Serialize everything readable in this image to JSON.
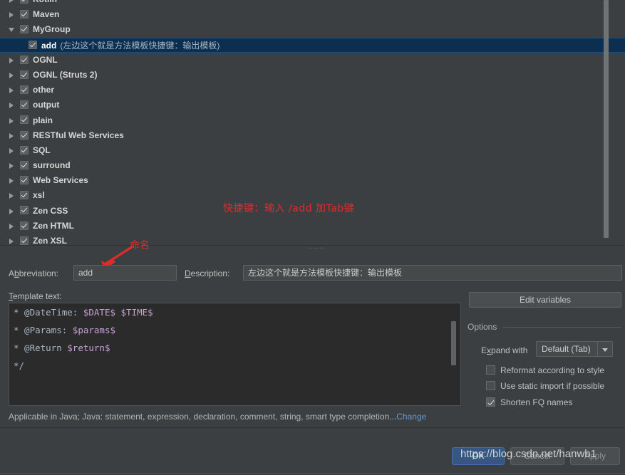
{
  "theme": {
    "window_bg": "#3c3f41",
    "selection_bg": "#0d2f4f",
    "editor_bg": "#2b2b2b",
    "accent_blue": "#365880",
    "link_blue": "#6897d0",
    "annotation_red": "#e02b2b",
    "variable_purple": "#c8a0d8"
  },
  "tree": {
    "rows": [
      {
        "label": "Kotlin",
        "description": "",
        "expandable": true,
        "expanded": false,
        "checked": true,
        "child": false,
        "selected": false
      },
      {
        "label": "Maven",
        "description": "",
        "expandable": true,
        "expanded": false,
        "checked": true,
        "child": false,
        "selected": false
      },
      {
        "label": "MyGroup",
        "description": "",
        "expandable": true,
        "expanded": true,
        "checked": true,
        "child": false,
        "selected": false
      },
      {
        "label": "add",
        "description": "(左边这个就是方法模板快捷键：输出模板)",
        "expandable": false,
        "expanded": false,
        "checked": true,
        "child": true,
        "selected": true
      },
      {
        "label": "OGNL",
        "description": "",
        "expandable": true,
        "expanded": false,
        "checked": true,
        "child": false,
        "selected": false
      },
      {
        "label": "OGNL (Struts 2)",
        "description": "",
        "expandable": true,
        "expanded": false,
        "checked": true,
        "child": false,
        "selected": false
      },
      {
        "label": "other",
        "description": "",
        "expandable": true,
        "expanded": false,
        "checked": true,
        "child": false,
        "selected": false
      },
      {
        "label": "output",
        "description": "",
        "expandable": true,
        "expanded": false,
        "checked": true,
        "child": false,
        "selected": false
      },
      {
        "label": "plain",
        "description": "",
        "expandable": true,
        "expanded": false,
        "checked": true,
        "child": false,
        "selected": false
      },
      {
        "label": "RESTful Web Services",
        "description": "",
        "expandable": true,
        "expanded": false,
        "checked": true,
        "child": false,
        "selected": false
      },
      {
        "label": "SQL",
        "description": "",
        "expandable": true,
        "expanded": false,
        "checked": true,
        "child": false,
        "selected": false
      },
      {
        "label": "surround",
        "description": "",
        "expandable": true,
        "expanded": false,
        "checked": true,
        "child": false,
        "selected": false
      },
      {
        "label": "Web Services",
        "description": "",
        "expandable": true,
        "expanded": false,
        "checked": true,
        "child": false,
        "selected": false
      },
      {
        "label": "xsl",
        "description": "",
        "expandable": true,
        "expanded": false,
        "checked": true,
        "child": false,
        "selected": false
      },
      {
        "label": "Zen CSS",
        "description": "",
        "expandable": true,
        "expanded": false,
        "checked": true,
        "child": false,
        "selected": false
      },
      {
        "label": "Zen HTML",
        "description": "",
        "expandable": true,
        "expanded": false,
        "checked": true,
        "child": false,
        "selected": false
      },
      {
        "label": "Zen XSL",
        "description": "",
        "expandable": true,
        "expanded": false,
        "checked": true,
        "child": false,
        "selected": false
      }
    ]
  },
  "annotations": {
    "shortcut_note": "快捷键：输入 /add 加Tab键",
    "naming_note": "命名"
  },
  "form": {
    "abbreviation_label": "Abbreviation:",
    "abbreviation_label_mnemonic": "b",
    "abbreviation_value": "add",
    "description_label": "Description:",
    "description_value": "左边这个就是方法模板快捷键：输出模板",
    "template_text_label": "Template text:",
    "template_lines": [
      {
        "prefix": "* @DateTime: ",
        "vars": [
          "$DATE$",
          " ",
          "$TIME$"
        ],
        "suffix": ""
      },
      {
        "prefix": "* @Params: ",
        "vars": [
          "$params$"
        ],
        "suffix": ""
      },
      {
        "prefix": "* @Return ",
        "vars": [
          "$return$"
        ],
        "suffix": ""
      },
      {
        "prefix": "*/",
        "vars": [],
        "suffix": ""
      }
    ]
  },
  "options": {
    "edit_variables_label": "Edit variables",
    "legend": "Options",
    "expand_with_label": "Expand with",
    "expand_with_value": "Default (Tab)",
    "checkboxes": [
      {
        "label": "Reformat according to style",
        "checked": false
      },
      {
        "label": "Use static import if possible",
        "checked": false
      },
      {
        "label": "Shorten FQ names",
        "checked": true
      }
    ]
  },
  "applicable": {
    "text": "Applicable in Java; Java: statement, expression, declaration, comment, string, smart type completion...",
    "change_link": "Change"
  },
  "buttons": {
    "ok": "OK",
    "cancel": "Cancel",
    "apply": "Apply"
  },
  "watermark": "https://blog.csdn.net/hanwb1"
}
